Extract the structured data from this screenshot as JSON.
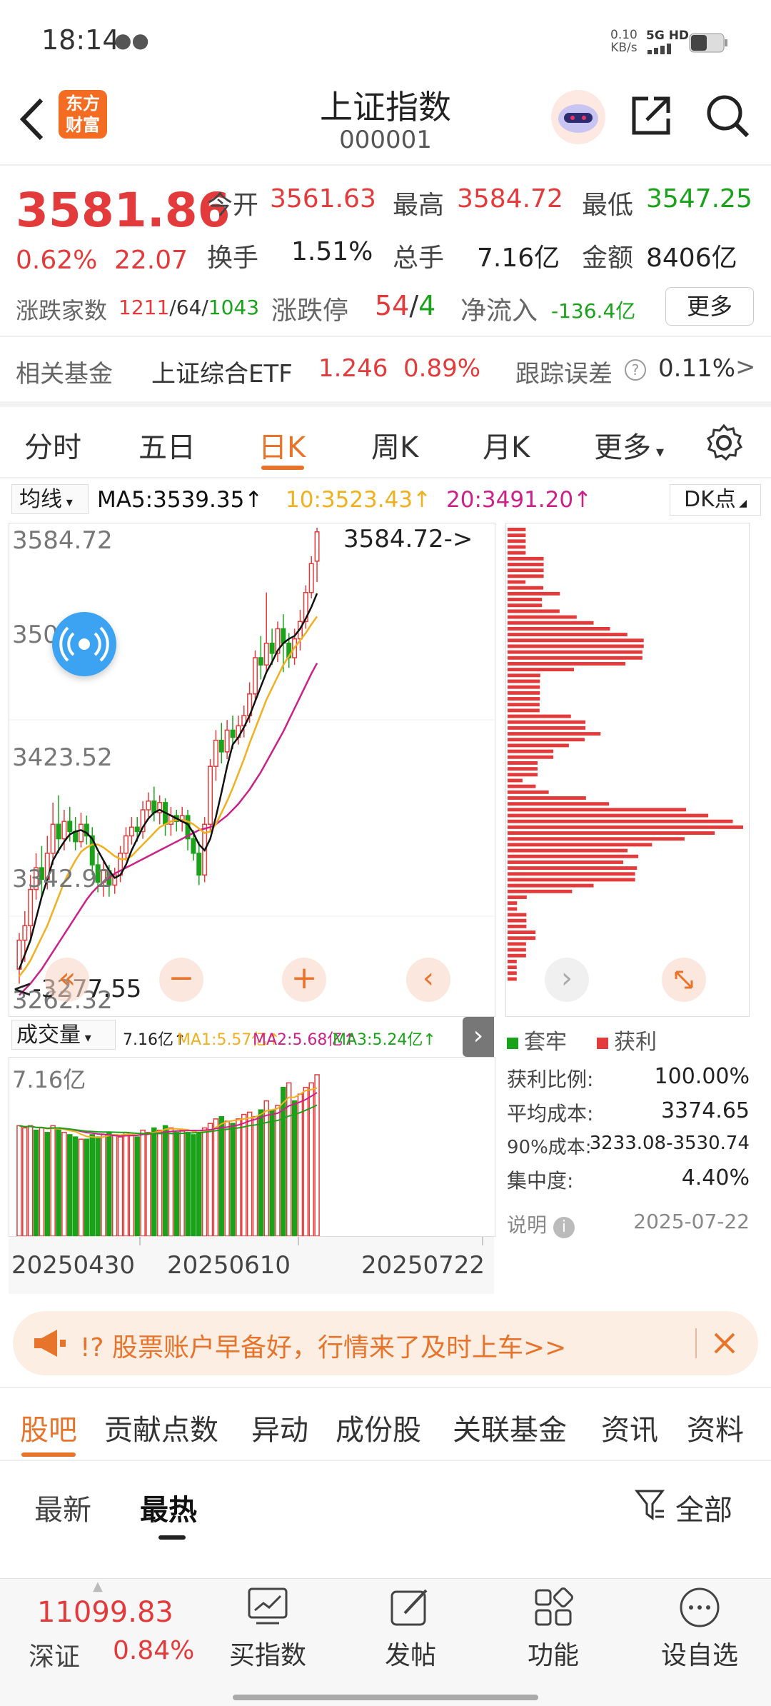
{
  "status_bar": {
    "time": "18:14",
    "net_speed": "0.10",
    "net_unit": "KB/s",
    "signal": "5G HD"
  },
  "header": {
    "title": "上证指数",
    "code": "000001",
    "logo_line1": "东方",
    "logo_line2": "财富"
  },
  "quote": {
    "price": "3581.86",
    "pct": "0.62%",
    "change": "22.07",
    "open_label": "今开",
    "open": "3561.63",
    "high_label": "最高",
    "high": "3584.72",
    "low_label": "最低",
    "low": "3547.25",
    "turnover_label": "换手",
    "turnover": "1.51%",
    "volume_label": "总手",
    "volume": "7.16亿",
    "amount_label": "金额",
    "amount": "8406亿",
    "adv_label": "涨跌家数",
    "adv_up": "1211",
    "adv_flat": "/64/",
    "adv_down": "1043",
    "limit_label": "涨跌停",
    "limit_up": "54",
    "limit_slash": "/",
    "limit_down": "4",
    "netflow_label": "净流入",
    "netflow": "-136.4亿",
    "more_button": "更多"
  },
  "fund_row": {
    "label": "相关基金",
    "name": "上证综合ETF",
    "price": "1.246",
    "pct": "0.89%",
    "tracking_label": "跟踪误差",
    "tracking": "0.11%",
    "arrow": ">"
  },
  "chart_tabs": [
    "分时",
    "五日",
    "日K",
    "周K",
    "月K",
    "更多"
  ],
  "ma_bar": {
    "selector": "均线",
    "ma5": "MA5:3539.35↑",
    "ma10": "10:3523.43↑",
    "ma20": "20:3491.20↑",
    "dk_button": "DK点"
  },
  "price_axis": [
    "3584.72",
    "3503.12",
    "3423.52",
    "3342.92",
    "3262.32"
  ],
  "annotations": {
    "high": "3584.72->",
    "low": "<-3277.55"
  },
  "volume_bar": {
    "selector": "成交量",
    "vol": "7.16亿↑",
    "ma1": "MA1:5.57亿↑",
    "ma2": "MA2:5.68亿↑",
    "ma3": "MA3:5.24亿↑",
    "axis_top": "7.16亿"
  },
  "dates": [
    "20250430",
    "20250610",
    "20250722"
  ],
  "distribution": {
    "legend_trapped": "套牢",
    "legend_profit": "获利",
    "rows": [
      {
        "label": "获利比例:",
        "value": "100.00%"
      },
      {
        "label": "平均成本:",
        "value": "3374.65"
      },
      {
        "label": "90%成本:",
        "value": "3233.08-3530.74"
      },
      {
        "label": "集中度:",
        "value": "4.40%"
      }
    ],
    "note_label": "说明",
    "date": "2025-07-22"
  },
  "banner": {
    "text": "!? 股票账户早备好，行情来了及时上车>>"
  },
  "section_tabs": [
    "股吧",
    "贡献点数",
    "异动",
    "成份股",
    "关联基金",
    "资讯",
    "资料"
  ],
  "sub_tabs": {
    "latest": "最新",
    "hot": "最热",
    "filter": "全部"
  },
  "bottom_bar": {
    "index_value": "11099.83",
    "index_name": "深证",
    "index_pct": "0.84%",
    "buy": "买指数",
    "post": "发帖",
    "func": "功能",
    "watch": "设自选"
  },
  "colors": {
    "up": "#e33b3b",
    "down": "#1aa31a",
    "accent": "#e8742b",
    "ma5": "#111111",
    "ma10": "#f0b020",
    "ma20": "#cc2288"
  },
  "chart_data": [
    {
      "type": "candlestick",
      "title": "日K",
      "ylim": [
        3262.32,
        3584.72
      ],
      "candles": [
        {
          "o": 3280,
          "c": 3300,
          "h": 3305,
          "l": 3270
        },
        {
          "o": 3300,
          "c": 3310,
          "h": 3320,
          "l": 3285
        },
        {
          "o": 3310,
          "c": 3335,
          "h": 3345,
          "l": 3300
        },
        {
          "o": 3335,
          "c": 3350,
          "h": 3360,
          "l": 3328
        },
        {
          "o": 3350,
          "c": 3342,
          "h": 3365,
          "l": 3330
        },
        {
          "o": 3342,
          "c": 3360,
          "h": 3372,
          "l": 3335
        },
        {
          "o": 3360,
          "c": 3380,
          "h": 3395,
          "l": 3352
        },
        {
          "o": 3380,
          "c": 3370,
          "h": 3400,
          "l": 3360
        },
        {
          "o": 3370,
          "c": 3382,
          "h": 3390,
          "l": 3362
        },
        {
          "o": 3382,
          "c": 3375,
          "h": 3392,
          "l": 3368
        },
        {
          "o": 3375,
          "c": 3368,
          "h": 3385,
          "l": 3362
        },
        {
          "o": 3368,
          "c": 3380,
          "h": 3388,
          "l": 3364
        },
        {
          "o": 3380,
          "c": 3372,
          "h": 3386,
          "l": 3366
        },
        {
          "o": 3372,
          "c": 3352,
          "h": 3378,
          "l": 3345
        },
        {
          "o": 3352,
          "c": 3340,
          "h": 3360,
          "l": 3333
        },
        {
          "o": 3340,
          "c": 3348,
          "h": 3355,
          "l": 3330
        },
        {
          "o": 3348,
          "c": 3338,
          "h": 3352,
          "l": 3330
        },
        {
          "o": 3338,
          "c": 3345,
          "h": 3350,
          "l": 3332
        },
        {
          "o": 3345,
          "c": 3360,
          "h": 3365,
          "l": 3340
        },
        {
          "o": 3360,
          "c": 3372,
          "h": 3378,
          "l": 3355
        },
        {
          "o": 3372,
          "c": 3378,
          "h": 3385,
          "l": 3366
        },
        {
          "o": 3378,
          "c": 3375,
          "h": 3385,
          "l": 3368
        },
        {
          "o": 3375,
          "c": 3390,
          "h": 3396,
          "l": 3370
        },
        {
          "o": 3390,
          "c": 3396,
          "h": 3402,
          "l": 3385
        },
        {
          "o": 3396,
          "c": 3388,
          "h": 3406,
          "l": 3382
        },
        {
          "o": 3388,
          "c": 3395,
          "h": 3400,
          "l": 3380
        },
        {
          "o": 3395,
          "c": 3380,
          "h": 3398,
          "l": 3372
        },
        {
          "o": 3380,
          "c": 3386,
          "h": 3392,
          "l": 3372
        },
        {
          "o": 3386,
          "c": 3382,
          "h": 3390,
          "l": 3375
        },
        {
          "o": 3382,
          "c": 3386,
          "h": 3392,
          "l": 3375
        },
        {
          "o": 3386,
          "c": 3370,
          "h": 3390,
          "l": 3362
        },
        {
          "o": 3370,
          "c": 3360,
          "h": 3376,
          "l": 3355
        },
        {
          "o": 3360,
          "c": 3345,
          "h": 3368,
          "l": 3338
        },
        {
          "o": 3345,
          "c": 3380,
          "h": 3385,
          "l": 3340
        },
        {
          "o": 3380,
          "c": 3420,
          "h": 3425,
          "l": 3375
        },
        {
          "o": 3420,
          "c": 3438,
          "h": 3445,
          "l": 3410
        },
        {
          "o": 3438,
          "c": 3430,
          "h": 3450,
          "l": 3422
        },
        {
          "o": 3430,
          "c": 3445,
          "h": 3452,
          "l": 3425
        },
        {
          "o": 3445,
          "c": 3440,
          "h": 3455,
          "l": 3432
        },
        {
          "o": 3440,
          "c": 3448,
          "h": 3455,
          "l": 3435
        },
        {
          "o": 3448,
          "c": 3455,
          "h": 3462,
          "l": 3440
        },
        {
          "o": 3455,
          "c": 3470,
          "h": 3478,
          "l": 3450
        },
        {
          "o": 3470,
          "c": 3495,
          "h": 3500,
          "l": 3465
        },
        {
          "o": 3495,
          "c": 3490,
          "h": 3510,
          "l": 3480
        },
        {
          "o": 3490,
          "c": 3505,
          "h": 3540,
          "l": 3485
        },
        {
          "o": 3505,
          "c": 3498,
          "h": 3515,
          "l": 3490
        },
        {
          "o": 3498,
          "c": 3515,
          "h": 3520,
          "l": 3492
        },
        {
          "o": 3515,
          "c": 3505,
          "h": 3525,
          "l": 3485
        },
        {
          "o": 3505,
          "c": 3495,
          "h": 3512,
          "l": 3488
        },
        {
          "o": 3495,
          "c": 3508,
          "h": 3515,
          "l": 3490
        },
        {
          "o": 3508,
          "c": 3520,
          "h": 3528,
          "l": 3500
        },
        {
          "o": 3520,
          "c": 3540,
          "h": 3545,
          "l": 3515
        },
        {
          "o": 3540,
          "c": 3560,
          "h": 3565,
          "l": 3536
        },
        {
          "o": 3561.63,
          "c": 3581.86,
          "h": 3584.72,
          "l": 3547.25
        }
      ],
      "ma5": [
        3280,
        3290,
        3300,
        3315,
        3330,
        3342,
        3355,
        3362,
        3368,
        3373,
        3375,
        3376,
        3374,
        3370,
        3362,
        3355,
        3348,
        3343,
        3345,
        3352,
        3362,
        3370,
        3378,
        3384,
        3388,
        3390,
        3388,
        3386,
        3384,
        3382,
        3380,
        3374,
        3366,
        3362,
        3370,
        3385,
        3402,
        3420,
        3435,
        3440,
        3447,
        3455,
        3465,
        3475,
        3485,
        3492,
        3500,
        3505,
        3508,
        3510,
        3515,
        3522,
        3530,
        3539.35
      ],
      "ma10": [
        3275,
        3280,
        3286,
        3294,
        3302,
        3310,
        3320,
        3330,
        3340,
        3348,
        3355,
        3361,
        3364,
        3366,
        3366,
        3364,
        3361,
        3358,
        3356,
        3356,
        3358,
        3362,
        3366,
        3370,
        3374,
        3378,
        3380,
        3382,
        3383,
        3383,
        3382,
        3380,
        3377,
        3374,
        3375,
        3380,
        3388,
        3396,
        3405,
        3415,
        3425,
        3436,
        3446,
        3456,
        3466,
        3474,
        3482,
        3490,
        3496,
        3502,
        3507,
        3512,
        3518,
        3523.43
      ],
      "ma20": [
        3262,
        3266,
        3270,
        3275,
        3280,
        3286,
        3292,
        3298,
        3304,
        3310,
        3316,
        3322,
        3328,
        3333,
        3337,
        3340,
        3343,
        3346,
        3348,
        3350,
        3352,
        3354,
        3356,
        3358,
        3360,
        3362,
        3364,
        3366,
        3368,
        3370,
        3372,
        3374,
        3376,
        3377,
        3378,
        3380,
        3383,
        3386,
        3390,
        3394,
        3399,
        3404,
        3410,
        3416,
        3423,
        3430,
        3437,
        3444,
        3452,
        3460,
        3468,
        3476,
        3484,
        3491.2
      ]
    },
    {
      "type": "bar",
      "title": "成交量",
      "ylim": [
        0,
        7.16
      ],
      "values": [
        4.9,
        4.8,
        4.9,
        4.7,
        4.8,
        4.6,
        4.9,
        4.8,
        4.6,
        4.5,
        4.4,
        4.3,
        4.3,
        4.5,
        4.4,
        4.5,
        4.6,
        4.5,
        4.4,
        4.6,
        4.5,
        4.4,
        4.7,
        4.6,
        4.8,
        4.7,
        4.9,
        4.8,
        4.6,
        4.7,
        4.6,
        4.5,
        4.6,
        4.8,
        5.0,
        5.2,
        5.3,
        5.1,
        5.0,
        5.2,
        5.4,
        5.5,
        5.3,
        5.6,
        6.0,
        5.6,
        5.8,
        6.6,
        6.8,
        6.0,
        6.3,
        6.6,
        6.8,
        7.16
      ],
      "up": [
        1,
        1,
        1,
        0,
        1,
        0,
        1,
        0,
        1,
        0,
        0,
        1,
        0,
        0,
        0,
        1,
        0,
        1,
        1,
        1,
        1,
        0,
        1,
        1,
        0,
        1,
        0,
        1,
        0,
        1,
        0,
        0,
        0,
        1,
        1,
        1,
        0,
        1,
        0,
        1,
        1,
        1,
        1,
        0,
        1,
        0,
        1,
        0,
        1,
        0,
        1,
        1,
        1,
        1
      ]
    }
  ]
}
